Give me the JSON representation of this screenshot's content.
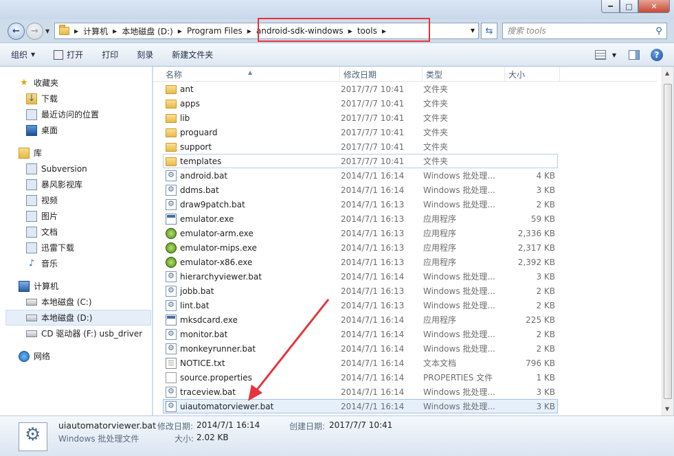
{
  "window": {
    "minimize": "━",
    "maximize": "□",
    "close": "✕"
  },
  "nav": {
    "address": [
      "计算机",
      "本地磁盘 (D:)",
      "Program Files",
      "android-sdk-windows",
      "tools"
    ],
    "search_placeholder": "搜索 tools"
  },
  "toolbar": {
    "organize": "组织",
    "open": "打开",
    "print": "打印",
    "burn": "刻录",
    "new_folder": "新建文件夹"
  },
  "sidebar": {
    "favorites": "收藏夹",
    "downloads": "下载",
    "recent": "最近访问的位置",
    "desktop": "桌面",
    "libraries": "库",
    "subversion": "Subversion",
    "baofeng": "暴风影视库",
    "videos": "视频",
    "pictures": "图片",
    "documents": "文档",
    "xunlei": "迅雷下载",
    "music": "音乐",
    "computer": "计算机",
    "drive_c": "本地磁盘 (C:)",
    "drive_d": "本地磁盘 (D:)",
    "drive_f": "CD 驱动器 (F:) usb_driver",
    "network": "网络"
  },
  "columns": {
    "name": "名称",
    "date": "修改日期",
    "type": "类型",
    "size": "大小"
  },
  "files": [
    {
      "name": "ant",
      "date": "2017/7/7 10:41",
      "type": "文件夹",
      "size": "",
      "icon": "folder"
    },
    {
      "name": "apps",
      "date": "2017/7/7 10:41",
      "type": "文件夹",
      "size": "",
      "icon": "folder"
    },
    {
      "name": "lib",
      "date": "2017/7/7 10:41",
      "type": "文件夹",
      "size": "",
      "icon": "folder"
    },
    {
      "name": "proguard",
      "date": "2017/7/7 10:41",
      "type": "文件夹",
      "size": "",
      "icon": "folder"
    },
    {
      "name": "support",
      "date": "2017/7/7 10:41",
      "type": "文件夹",
      "size": "",
      "icon": "folder"
    },
    {
      "name": "templates",
      "date": "2017/7/7 10:41",
      "type": "文件夹",
      "size": "",
      "icon": "folder"
    },
    {
      "name": "android.bat",
      "date": "2014/7/1 16:14",
      "type": "Windows 批处理...",
      "size": "4 KB",
      "icon": "bat"
    },
    {
      "name": "ddms.bat",
      "date": "2014/7/1 16:14",
      "type": "Windows 批处理...",
      "size": "3 KB",
      "icon": "bat"
    },
    {
      "name": "draw9patch.bat",
      "date": "2014/7/1 16:13",
      "type": "Windows 批处理...",
      "size": "2 KB",
      "icon": "bat"
    },
    {
      "name": "emulator.exe",
      "date": "2014/7/1 16:13",
      "type": "应用程序",
      "size": "59 KB",
      "icon": "exe"
    },
    {
      "name": "emulator-arm.exe",
      "date": "2014/7/1 16:13",
      "type": "应用程序",
      "size": "2,336 KB",
      "icon": "emu"
    },
    {
      "name": "emulator-mips.exe",
      "date": "2014/7/1 16:13",
      "type": "应用程序",
      "size": "2,317 KB",
      "icon": "emu"
    },
    {
      "name": "emulator-x86.exe",
      "date": "2014/7/1 16:13",
      "type": "应用程序",
      "size": "2,392 KB",
      "icon": "emu"
    },
    {
      "name": "hierarchyviewer.bat",
      "date": "2014/7/1 16:14",
      "type": "Windows 批处理...",
      "size": "3 KB",
      "icon": "bat"
    },
    {
      "name": "jobb.bat",
      "date": "2014/7/1 16:13",
      "type": "Windows 批处理...",
      "size": "2 KB",
      "icon": "bat"
    },
    {
      "name": "lint.bat",
      "date": "2014/7/1 16:13",
      "type": "Windows 批处理...",
      "size": "2 KB",
      "icon": "bat"
    },
    {
      "name": "mksdcard.exe",
      "date": "2014/7/1 16:14",
      "type": "应用程序",
      "size": "225 KB",
      "icon": "exe"
    },
    {
      "name": "monitor.bat",
      "date": "2014/7/1 16:14",
      "type": "Windows 批处理...",
      "size": "2 KB",
      "icon": "bat"
    },
    {
      "name": "monkeyrunner.bat",
      "date": "2014/7/1 16:14",
      "type": "Windows 批处理...",
      "size": "2 KB",
      "icon": "bat"
    },
    {
      "name": "NOTICE.txt",
      "date": "2014/7/1 16:14",
      "type": "文本文档",
      "size": "796 KB",
      "icon": "txt"
    },
    {
      "name": "source.properties",
      "date": "2014/7/1 16:14",
      "type": "PROPERTIES 文件",
      "size": "1 KB",
      "icon": "doc"
    },
    {
      "name": "traceview.bat",
      "date": "2014/7/1 16:14",
      "type": "Windows 批处理...",
      "size": "3 KB",
      "icon": "bat"
    },
    {
      "name": "uiautomatorviewer.bat",
      "date": "2014/7/1 16:14",
      "type": "Windows 批处理...",
      "size": "3 KB",
      "icon": "bat"
    }
  ],
  "details": {
    "name": "uiautomatorviewer.bat",
    "type": "Windows 批处理文件",
    "modified_label": "修改日期:",
    "modified": "2014/7/1 16:14",
    "created_label": "创建日期:",
    "created": "2017/7/7 10:41",
    "size_label": "大小:",
    "size": "2.02 KB"
  }
}
